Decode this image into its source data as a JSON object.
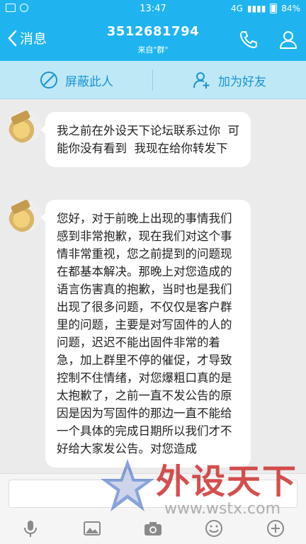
{
  "status_bar": {
    "time": "13:47",
    "network": "4G",
    "battery": "84%"
  },
  "header": {
    "back_label": "消息",
    "title": "3512681794",
    "subtitle": "来自\"群\""
  },
  "actions": {
    "block_label": "屏蔽此人",
    "add_friend_label": "加为好友"
  },
  "messages": [
    {
      "text": "我之前在外设天下论坛联系过你  可能你没有看到  我现在给你转发下"
    },
    {
      "text": "您好，对于前晚上出现的事情我们感到非常抱歉，现在我们对这个事情非常重视，您之前提到的问题现在都基本解决。那晚上对您造成的语言伤害真的抱歉，当时也是我们出现了很多问题，不仅仅是客户群里的问题，主要是对写固件的人的问题，迟迟不能出固件非常的着急，加上群里不停的催促，才导致控制不住情绪，对您爆粗口真的是太抱歉了，之前一直不发公告的原因是因为写固件的那边一直不能给一个具体的完成日期所以我们才不好给大家发公告。对您造成"
    }
  ],
  "watermark": {
    "brand": "外设天下",
    "url": "www.wstx.com"
  },
  "colors": {
    "accent": "#1fb4f0",
    "action_bar": "#bfe8f7",
    "action_text": "#1793d3"
  }
}
